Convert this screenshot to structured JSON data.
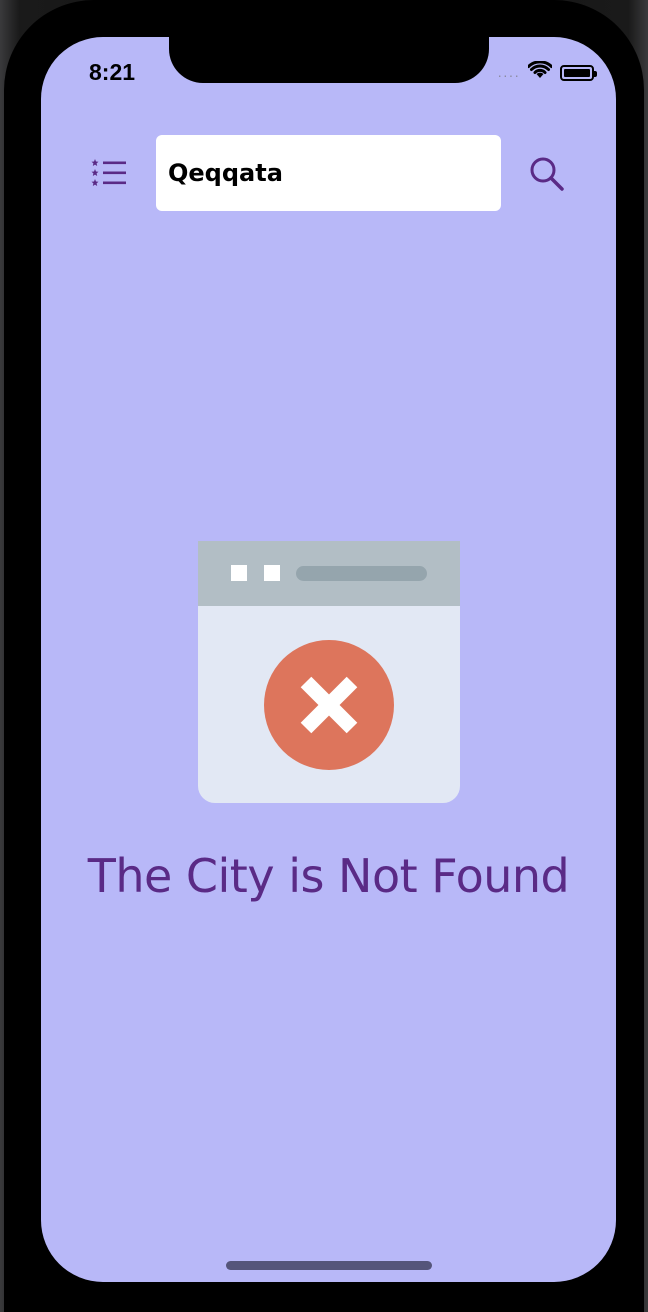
{
  "status_bar": {
    "time": "8:21",
    "signal_icon": "signal-dots-icon",
    "wifi_icon": "wifi-icon",
    "battery_icon": "battery-icon"
  },
  "header": {
    "menu_icon": "list-star-icon",
    "search_value": "Qeqqata",
    "search_icon": "search-icon"
  },
  "main": {
    "illustration_icon": "browser-error-icon",
    "message": "The City is Not Found"
  },
  "colors": {
    "background": "#b8b8f8",
    "accent": "#5a2a86",
    "error": "#dd755c",
    "window_header": "#b2bec5",
    "window_body": "#e2e8f4"
  }
}
